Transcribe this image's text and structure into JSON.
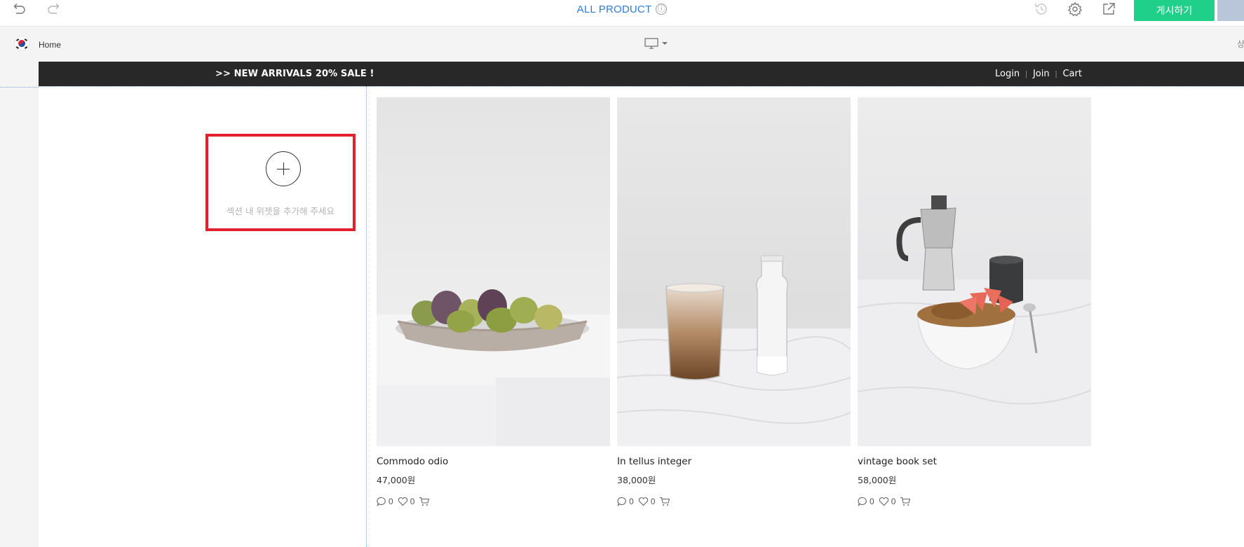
{
  "toolbar": {
    "title": "ALL PRODUCT",
    "info_icon": "ⓘ",
    "publish_label": "게시하기",
    "icons": [
      "undo-icon",
      "redo-icon",
      "info-icon",
      "history-icon",
      "gear-icon",
      "external-link-icon"
    ]
  },
  "subbar": {
    "language_flag": "korea-flag-icon",
    "page_name": "Home",
    "device": "desktop-icon",
    "right_cut_text": "상"
  },
  "site": {
    "banner": {
      "text": ">> NEW ARRIVALS 20% SALE !",
      "links": [
        "Login",
        "Join",
        "Cart"
      ],
      "separator": "|"
    },
    "add_widget": {
      "text": "섹션 내 위젯을 추가해 주세요"
    },
    "products": [
      {
        "name": "Commodo odio",
        "price": "47,000원",
        "reviews": "0",
        "likes": "0",
        "image": "figs-bowl-photo"
      },
      {
        "name": "In tellus integer",
        "price": "38,000원",
        "reviews": "0",
        "likes": "0",
        "image": "latte-milk-bottle-photo"
      },
      {
        "name": "vintage book set",
        "price": "58,000원",
        "reviews": "0",
        "likes": "0",
        "image": "granola-moka-pot-photo"
      }
    ]
  },
  "colors": {
    "accent_blue": "#2f7bd9",
    "publish_green": "#1fcf8a",
    "banner_dark": "#282828",
    "highlight_red": "#e5202e"
  }
}
